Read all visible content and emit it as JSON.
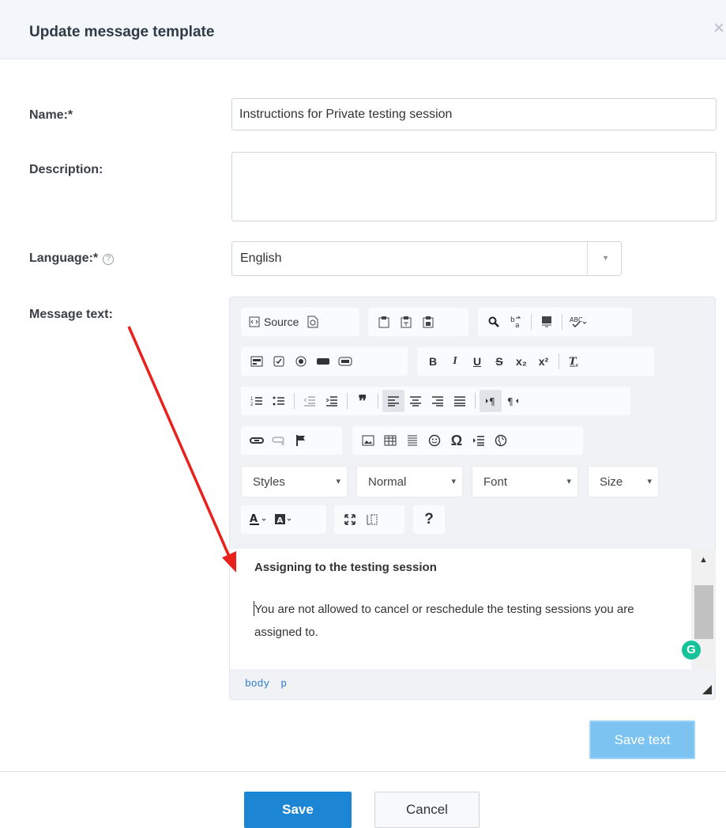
{
  "dialog": {
    "title": "Update message template",
    "close_icon": "close-icon"
  },
  "form": {
    "name_label": "Name:*",
    "name_value": "Instructions for Private testing session",
    "description_label": "Description:",
    "description_value": "",
    "language_label": "Language:*",
    "language_help_glyph": "?",
    "language_value": "English",
    "message_label": "Message text:"
  },
  "toolbar": {
    "source_label": "Source",
    "styles_label": "Styles",
    "format_label": "Normal",
    "font_label": "Font",
    "size_label": "Size",
    "bold": "B",
    "italic": "I",
    "underline": "U",
    "strike": "S",
    "subscript": "x₂",
    "superscript": "x²",
    "help": "?"
  },
  "editor": {
    "heading": "Assigning to the testing session",
    "body": "You are not allowed to cancel or reschedule the testing sessions you are assigned to.",
    "path": [
      "body",
      "p"
    ]
  },
  "buttons": {
    "save_text": "Save text",
    "save": "Save",
    "cancel": "Cancel"
  },
  "colors": {
    "primary": "#1d86d4",
    "save_text_bg": "#7cc3f2",
    "annotation_arrow": "#e8211c",
    "grammarly": "#15c39a"
  }
}
